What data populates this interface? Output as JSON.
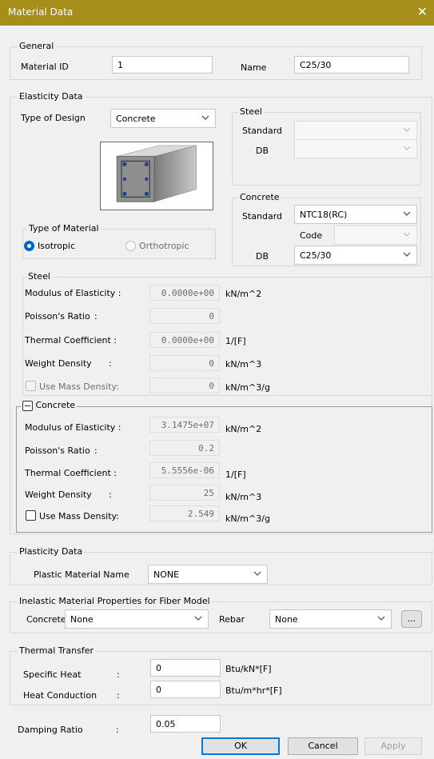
{
  "window": {
    "title": "Material Data",
    "close_glyph": "✕"
  },
  "general": {
    "group_label": "General",
    "material_id_label": "Material ID",
    "material_id_value": "1",
    "name_label": "Name",
    "name_value": "C25/30"
  },
  "elasticity": {
    "group_label": "Elasticity Data",
    "type_of_design_label": "Type of Design",
    "type_of_design_value": "Concrete",
    "steel_group": {
      "label": "Steel",
      "standard_label": "Standard",
      "standard_value": "",
      "db_label": "DB",
      "db_value": ""
    },
    "concrete_group": {
      "label": "Concrete",
      "standard_label": "Standard",
      "standard_value": "NTC18(RC)",
      "code_label": "Code",
      "code_value": "",
      "db_label": "DB",
      "db_value": "C25/30"
    },
    "type_of_material": {
      "label": "Type of Material",
      "isotropic_label": "Isotropic",
      "orthotropic_label": "Orthotropic",
      "selected": "Isotropic"
    },
    "steel_props": {
      "label": "Steel",
      "modulus_label": "Modulus of Elasticity :",
      "modulus_value": "0.0000e+00",
      "modulus_unit": "kN/m^2",
      "poisson_label": "Poisson's Ratio",
      "poisson_colon": ":",
      "poisson_value": "0",
      "thermal_label": "Thermal Coefficient  :",
      "thermal_value": "0.0000e+00",
      "thermal_unit": "1/[F]",
      "weight_label": "Weight Density",
      "weight_colon": ":",
      "weight_value": "0",
      "weight_unit": "kN/m^3",
      "mass_label": "Use Mass Density:",
      "mass_value": "0",
      "mass_unit": "kN/m^3/g",
      "mass_checked": false
    },
    "concrete_props": {
      "label": "Concrete",
      "modulus_label": "Modulus of Elasticity :",
      "modulus_value": "3.1475e+07",
      "modulus_unit": "kN/m^2",
      "poisson_label": "Poisson's Ratio",
      "poisson_colon": ":",
      "poisson_value": "0.2",
      "thermal_label": "Thermal Coefficient  :",
      "thermal_value": "5.5556e-06",
      "thermal_unit": "1/[F]",
      "weight_label": "Weight Density",
      "weight_colon": ":",
      "weight_value": "25",
      "weight_unit": "kN/m^3",
      "mass_label": "Use Mass Density:",
      "mass_value": "2.549",
      "mass_unit": "kN/m^3/g",
      "mass_checked": false
    }
  },
  "plasticity": {
    "group_label": "Plasticity Data",
    "plastic_material_label": "Plastic Material Name",
    "plastic_material_value": "NONE"
  },
  "inelastic": {
    "group_label": "Inelastic Material Properties for Fiber Model",
    "concrete_label": "Concrete",
    "concrete_value": "None",
    "rebar_label": "Rebar",
    "rebar_value": "None",
    "more_label": "..."
  },
  "thermal_transfer": {
    "group_label": "Thermal Transfer",
    "specific_heat_label": "Specific Heat",
    "specific_heat_colon": ":",
    "specific_heat_value": "0",
    "specific_heat_unit": "Btu/kN*[F]",
    "heat_conduction_label": "Heat Conduction",
    "heat_conduction_colon": ":",
    "heat_conduction_value": "0",
    "heat_conduction_unit": "Btu/m*hr*[F]"
  },
  "damping": {
    "label": "Damping Ratio",
    "colon": ":",
    "value": "0.05"
  },
  "buttons": {
    "ok": "OK",
    "cancel": "Cancel",
    "apply": "Apply"
  },
  "colors": {
    "titlebar": "#a68e1b",
    "accent": "#0067c0"
  }
}
